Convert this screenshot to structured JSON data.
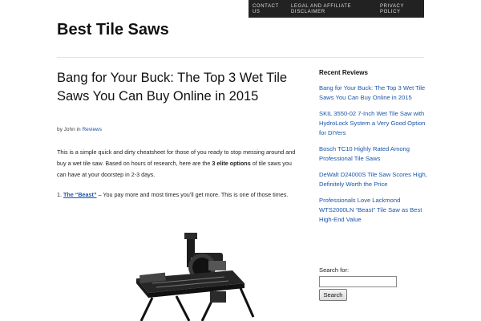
{
  "nav": {
    "contact": "CONTACT US",
    "legal": "LEGAL AND AFFILIATE DISCLAIMER",
    "privacy": "PRIVACY POLICY"
  },
  "site": {
    "title": "Best Tile Saws"
  },
  "post": {
    "title": "Bang for Your Buck: The Top 3 Wet Tile Saws You Can Buy Online in 2015",
    "byline_prefix": "by John in ",
    "category": "Reviews",
    "intro_a": "This is a simple quick and dirty cheatsheet for those of you ready to stop messing around and buy a wet tile saw.  Based on hours of research, here are the ",
    "intro_bold": "3 elite options",
    "intro_b": " of tile saws you can have at your doorstep in 2-3 days.",
    "item1_num": "1. ",
    "item1_link": "The “Beast”",
    "item1_text": " – You pay more and most times you’ll get more.  This is one of those times."
  },
  "sidebar": {
    "recent_title": "Recent Reviews",
    "recent": [
      "Bang for Your Buck: The Top 3 Wet Tile Saws You Can Buy Online in 2015",
      "SKIL 3550-02 7-Inch Wet Tile Saw with HydroLock System a Very Good Option for DIYers",
      "Bosch TC10 Highly Rated Among Professional Tile Saws",
      "DeWalt D24000S Tile Saw Scores High, Definitely Worth the Price",
      "Professionals Love Lackmond WTS2000LN “Beast” Tile Saw as Best High-End Value"
    ],
    "search_label": "Search for:",
    "search_value": "",
    "search_button": "Search"
  }
}
